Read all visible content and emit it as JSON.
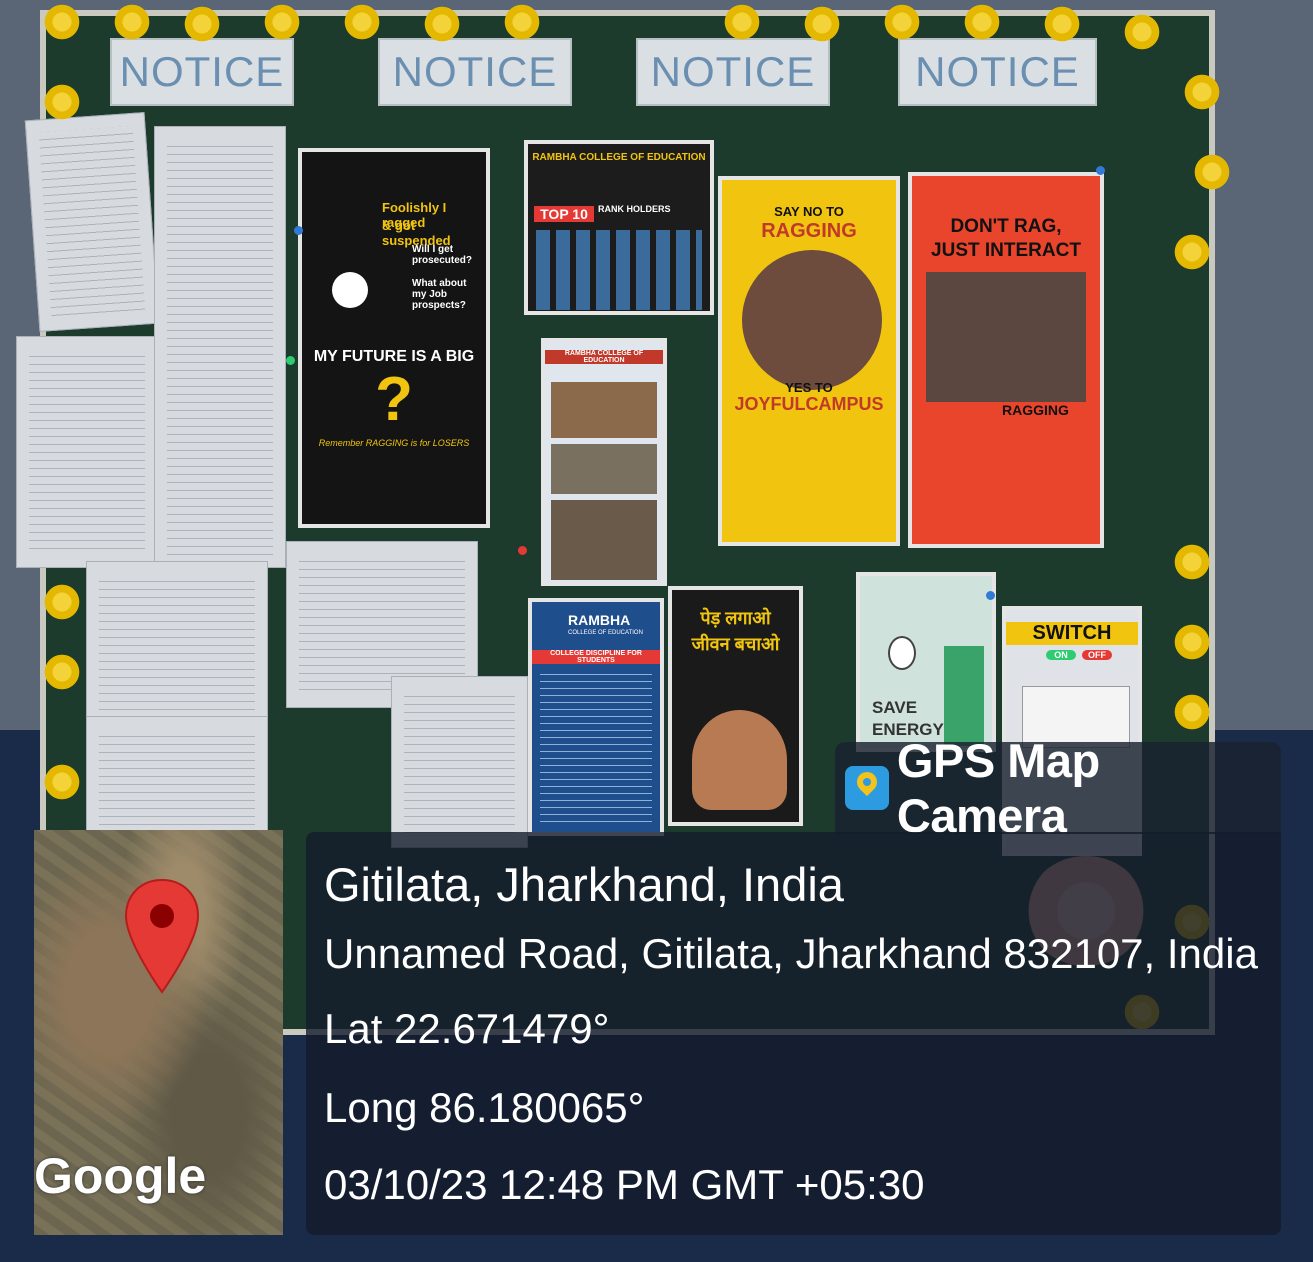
{
  "board": {
    "notice_tags": [
      "NOTICE",
      "NOTICE",
      "NOTICE",
      "NOTICE"
    ],
    "posters": {
      "future_poster": {
        "line1": "Foolishly I ragged",
        "line2": "& got suspended",
        "line3": "Will I get prosecuted?",
        "line4": "What about my Job prospects?",
        "headline": "MY FUTURE IS A BIG",
        "mark": "?",
        "footer": "Remember RAGGING is for LOSERS"
      },
      "rambha_rank": {
        "college": "RAMBHA COLLEGE OF EDUCATION",
        "headline": "TOP 10",
        "sub": "RANK HOLDERS"
      },
      "say_no_ragging": {
        "top": "SAY NO TO",
        "headline": "RAGGING",
        "yes": "YES TO",
        "bottom": "JOYFULCAMPUS"
      },
      "dont_rag": {
        "line1": "DON'T RAG,",
        "line2": "JUST INTERACT",
        "tag": "RAGGING"
      },
      "rambha_tour": {
        "college": "RAMBHA COLLEGE OF EDUCATION"
      },
      "discipline": {
        "college": "RAMBHA",
        "sub": "COLLEGE OF EDUCATION",
        "headline": "COLLEGE DISCIPLINE FOR STUDENTS"
      },
      "tree": {
        "line1": "पेड़ लगाओ",
        "line2": "जीवन बचाओ"
      },
      "save_energy": {
        "line1": "SAVE",
        "line2": "ENERGY"
      },
      "switch": {
        "headline": "SWITCH",
        "on": "ON",
        "off": "OFF"
      }
    }
  },
  "gps": {
    "app_title": "GPS Map Camera",
    "place": "Gitilata, Jharkhand, India",
    "address": "Unnamed Road, Gitilata, Jharkhand 832107, India",
    "lat": "Lat 22.671479°",
    "long": "Long 86.180065°",
    "datetime": "03/10/23 12:48 PM GMT +05:30",
    "map_provider": "Google"
  },
  "colors": {
    "board_green": "#1d3b2c",
    "flower_yellow": "#f3d23a",
    "pin_red": "#e53935",
    "overlay_dark": "#141c2c"
  }
}
